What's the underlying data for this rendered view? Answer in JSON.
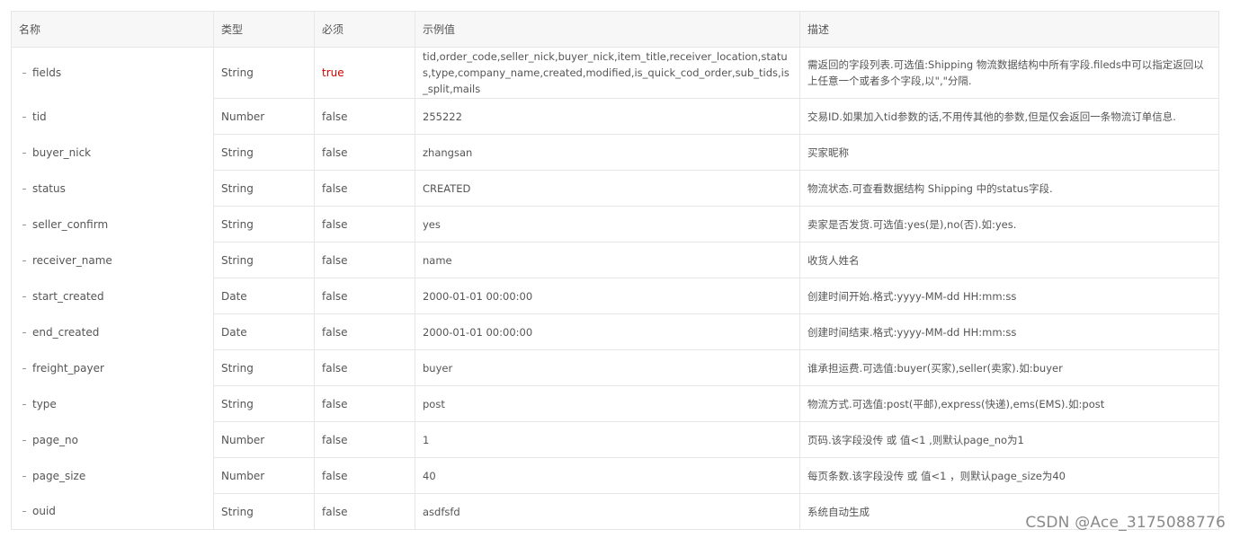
{
  "headers": {
    "name": "名称",
    "type": "类型",
    "required": "必须",
    "example": "示例值",
    "description": "描述"
  },
  "rows": [
    {
      "name": "fields",
      "type": "String",
      "required": "true",
      "example": "tid,order_code,seller_nick,buyer_nick,item_title,receiver_location,status,type,company_name,created,modified,is_quick_cod_order,sub_tids,is_split,mails",
      "description": "需返回的字段列表.可选值:Shipping 物流数据结构中所有字段.fileds中可以指定返回以上任意一个或者多个字段,以\",\"分隔."
    },
    {
      "name": "tid",
      "type": "Number",
      "required": "false",
      "example": "255222",
      "description": "交易ID.如果加入tid参数的话,不用传其他的参数,但是仅会返回一条物流订单信息."
    },
    {
      "name": "buyer_nick",
      "type": "String",
      "required": "false",
      "example": "zhangsan",
      "description": "买家昵称"
    },
    {
      "name": "status",
      "type": "String",
      "required": "false",
      "example": "CREATED",
      "description": "物流状态.可查看数据结构 Shipping 中的status字段."
    },
    {
      "name": "seller_confirm",
      "type": "String",
      "required": "false",
      "example": "yes",
      "description": "卖家是否发货.可选值:yes(是),no(否).如:yes."
    },
    {
      "name": "receiver_name",
      "type": "String",
      "required": "false",
      "example": "name",
      "description": "收货人姓名"
    },
    {
      "name": "start_created",
      "type": "Date",
      "required": "false",
      "example": "2000-01-01 00:00:00",
      "description": "创建时间开始.格式:yyyy-MM-dd HH:mm:ss"
    },
    {
      "name": "end_created",
      "type": "Date",
      "required": "false",
      "example": "2000-01-01 00:00:00",
      "description": "创建时间结束.格式:yyyy-MM-dd HH:mm:ss"
    },
    {
      "name": "freight_payer",
      "type": "String",
      "required": "false",
      "example": "buyer",
      "description": "谁承担运费.可选值:buyer(买家),seller(卖家).如:buyer"
    },
    {
      "name": "type",
      "type": "String",
      "required": "false",
      "example": "post",
      "description": "物流方式.可选值:post(平邮),express(快递),ems(EMS).如:post"
    },
    {
      "name": "page_no",
      "type": "Number",
      "required": "false",
      "example": "1",
      "description": "页码.该字段没传 或 值<1 ,则默认page_no为1"
    },
    {
      "name": "page_size",
      "type": "Number",
      "required": "false",
      "example": "40",
      "description": "每页条数.该字段没传 或 值<1 ，则默认page_size为40"
    },
    {
      "name": "ouid",
      "type": "String",
      "required": "false",
      "example": "asdfsfd",
      "description": "系统自动生成"
    }
  ],
  "watermark": "CSDN @Ace_3175088776",
  "colors": {
    "required_true": "#cc0000",
    "border": "#e6e6e6",
    "header_bg": "#f7f7f7",
    "text": "#555555"
  }
}
